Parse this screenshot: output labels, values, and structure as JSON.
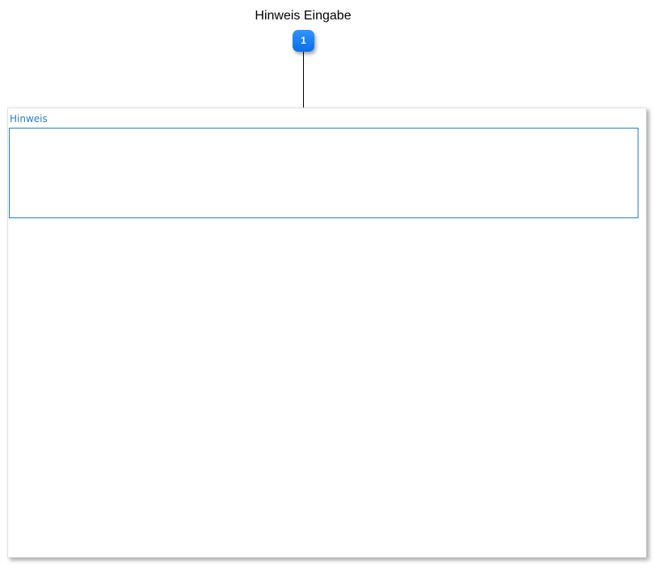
{
  "callout": {
    "title": "Hinweis Eingabe",
    "number": "1",
    "badge_color": "#1a7ff0"
  },
  "form": {
    "note": {
      "label": "Hinweis",
      "value": "",
      "accent_color": "#2c7fb8"
    }
  }
}
